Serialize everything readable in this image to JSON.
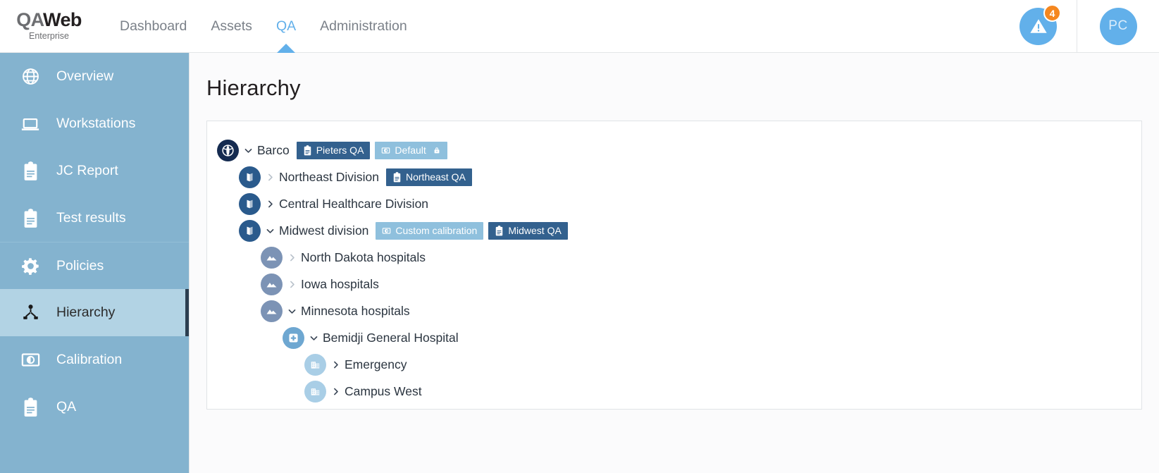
{
  "brand": {
    "q": "QA",
    "web": "Web",
    "sub": "Enterprise"
  },
  "nav": {
    "items": [
      {
        "label": "Dashboard",
        "active": false
      },
      {
        "label": "Assets",
        "active": false
      },
      {
        "label": "QA",
        "active": true
      },
      {
        "label": "Administration",
        "active": false
      }
    ]
  },
  "topright": {
    "alert_icon": "warning-triangle-icon",
    "alert_count": "4",
    "avatar_initials": "PC"
  },
  "sidebar": {
    "items": [
      {
        "label": "Overview",
        "icon": "globe-icon",
        "active": false,
        "group_top": false
      },
      {
        "label": "Workstations",
        "icon": "laptop-icon",
        "active": false,
        "group_top": false
      },
      {
        "label": "JC Report",
        "icon": "clipboard-icon",
        "active": false,
        "group_top": false
      },
      {
        "label": "Test results",
        "icon": "clipboard-icon",
        "active": false,
        "group_top": false
      },
      {
        "label": "Policies",
        "icon": "gear-icon",
        "active": false,
        "group_top": true
      },
      {
        "label": "Hierarchy",
        "icon": "hierarchy-icon",
        "active": true,
        "group_top": false
      },
      {
        "label": "Calibration",
        "icon": "calibration-icon",
        "active": false,
        "group_top": false
      },
      {
        "label": "QA",
        "icon": "clipboard-icon",
        "active": false,
        "group_top": false
      }
    ]
  },
  "page": {
    "title": "Hierarchy"
  },
  "tree": {
    "nodes": [
      {
        "label": "Barco",
        "icon": "globe-node-icon",
        "icon_class": "ico-root",
        "indent": 0,
        "caret": "expanded",
        "caret_dim": false,
        "chips": [
          {
            "label": "Pieters QA",
            "style": "dark",
            "icon": "clipboard-icon",
            "lock": false
          },
          {
            "label": "Default",
            "style": "light",
            "icon": "calibration-icon",
            "lock": true
          }
        ]
      },
      {
        "label": "Northeast Division",
        "icon": "map-node-icon",
        "icon_class": "ico-div",
        "indent": 1,
        "caret": "collapsed",
        "caret_dim": true,
        "chips": [
          {
            "label": "Northeast QA",
            "style": "dark",
            "icon": "clipboard-icon",
            "lock": false
          }
        ]
      },
      {
        "label": "Central Healthcare Division",
        "icon": "map-node-icon",
        "icon_class": "ico-div",
        "indent": 1,
        "caret": "collapsed",
        "caret_dim": false,
        "chips": []
      },
      {
        "label": "Midwest division",
        "icon": "map-node-icon",
        "icon_class": "ico-div",
        "indent": 1,
        "caret": "expanded",
        "caret_dim": false,
        "chips": [
          {
            "label": "Custom calibration",
            "style": "light",
            "icon": "calibration-icon",
            "lock": false
          },
          {
            "label": "Midwest QA",
            "style": "dark",
            "icon": "clipboard-icon",
            "lock": false
          }
        ]
      },
      {
        "label": "North Dakota hospitals",
        "icon": "region-node-icon",
        "icon_class": "ico-reg",
        "indent": 2,
        "caret": "collapsed",
        "caret_dim": true,
        "chips": []
      },
      {
        "label": "Iowa hospitals",
        "icon": "region-node-icon",
        "icon_class": "ico-reg",
        "indent": 2,
        "caret": "collapsed",
        "caret_dim": true,
        "chips": []
      },
      {
        "label": "Minnesota hospitals",
        "icon": "region-node-icon",
        "icon_class": "ico-reg",
        "indent": 2,
        "caret": "expanded",
        "caret_dim": false,
        "chips": []
      },
      {
        "label": "Bemidji General Hospital",
        "icon": "hospital-node-icon",
        "icon_class": "ico-hosp",
        "indent": 3,
        "caret": "expanded",
        "caret_dim": false,
        "chips": []
      },
      {
        "label": "Emergency",
        "icon": "department-node-icon",
        "icon_class": "ico-dept",
        "indent": 4,
        "caret": "collapsed",
        "caret_dim": false,
        "chips": []
      },
      {
        "label": "Campus West",
        "icon": "department-node-icon",
        "icon_class": "ico-dept",
        "indent": 4,
        "caret": "collapsed",
        "caret_dim": false,
        "chips": []
      }
    ]
  },
  "colors": {
    "accent": "#62b0ea",
    "sidebar": "#84b3cf",
    "sidebar_active": "#b2d3e4",
    "badge_orange": "#f5871f",
    "chip_dark": "#33618e",
    "chip_light": "#8fc0dd"
  }
}
